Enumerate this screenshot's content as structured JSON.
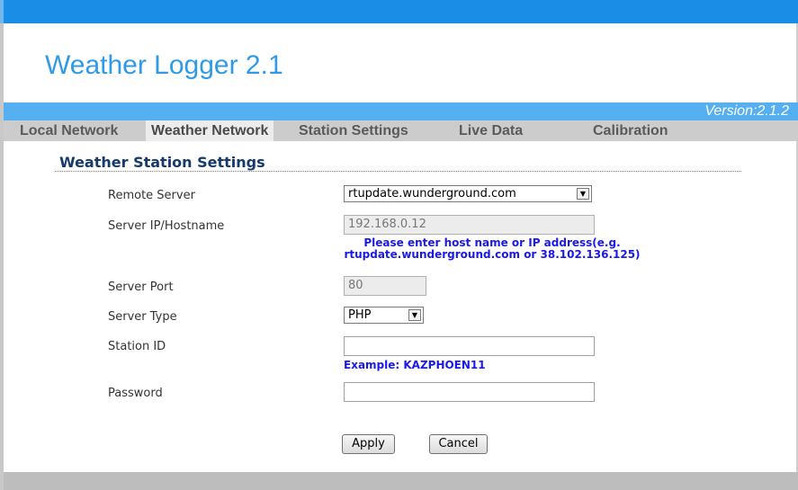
{
  "app": {
    "title": "Weather Logger 2.1",
    "version": "Version:2.1.2"
  },
  "tabs": [
    {
      "label": "Local Network",
      "active": false
    },
    {
      "label": "Weather Network",
      "active": true
    },
    {
      "label": "Station Settings",
      "active": false
    },
    {
      "label": "Live Data",
      "active": false
    },
    {
      "label": "Calibration",
      "active": false
    }
  ],
  "section": {
    "title": "Weather Station Settings"
  },
  "form": {
    "remote_server": {
      "label": "Remote Server",
      "value": "rtupdate.wunderground.com"
    },
    "server_ip": {
      "label": "Server IP/Hostname",
      "value": "192.168.0.12",
      "hint_line1": "Please enter host name or IP address(e.g.",
      "hint_line2": "rtupdate.wunderground.com or 38.102.136.125)"
    },
    "server_port": {
      "label": "Server Port",
      "value": "80"
    },
    "server_type": {
      "label": "Server Type",
      "value": "PHP"
    },
    "station_id": {
      "label": "Station ID",
      "value": "",
      "hint": "Example: KAZPHOEN11"
    },
    "password": {
      "label": "Password",
      "value": ""
    }
  },
  "buttons": {
    "apply": "Apply",
    "cancel": "Cancel"
  },
  "colors": {
    "accent": "#1a8ee6",
    "title": "#2f9be6",
    "section_title": "#153a6b",
    "hint": "#1a1ae6"
  },
  "icons": {
    "select_arrow": "dropdown-arrow-icon"
  }
}
